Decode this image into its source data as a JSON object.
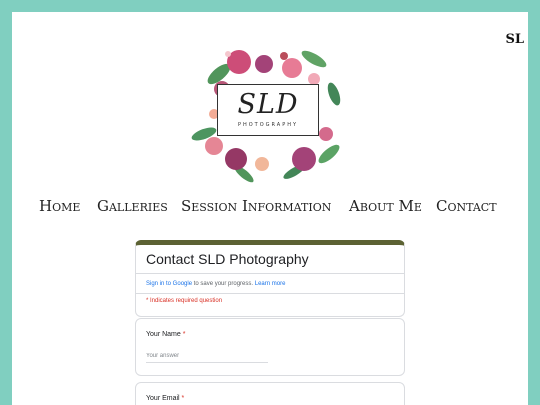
{
  "corner_mark": "SL",
  "logo": {
    "title": "SLD",
    "subtitle": "PHOTOGRAPHY"
  },
  "nav": [
    "Home",
    "Galleries",
    "Session Information",
    "About Me",
    "Contact"
  ],
  "form": {
    "title": "Contact SLD Photography",
    "signin_link": "Sign in to Google",
    "signin_text": " to save your progress. ",
    "learn_more": "Learn more",
    "required_note": "* Indicates required question",
    "questions": [
      {
        "label": "Your Name",
        "required": "*",
        "placeholder": "Your answer"
      },
      {
        "label": "Your Email",
        "required": "*"
      }
    ]
  },
  "colors": {
    "background": "#80cfc0",
    "form_accent": "#5c6233",
    "required": "#d93025",
    "link": "#1a73e8"
  }
}
